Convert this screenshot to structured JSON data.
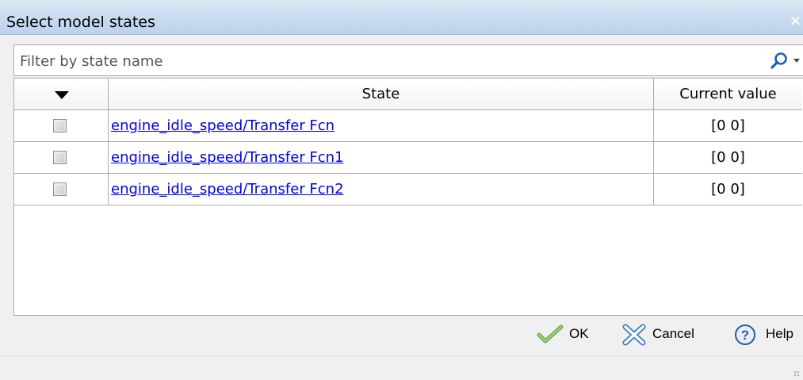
{
  "window": {
    "title": "Select model states",
    "close_glyph": "×"
  },
  "filter": {
    "placeholder": "Filter by state name",
    "value": "",
    "icon": "search-icon"
  },
  "table": {
    "columns": [
      "",
      "State",
      "Current value"
    ],
    "sort_icon": "sort-down-triangle-icon",
    "rows": [
      {
        "checked": false,
        "state": "engine_idle_speed/Transfer Fcn",
        "value": "[0 0]"
      },
      {
        "checked": false,
        "state": "engine_idle_speed/Transfer Fcn1",
        "value": "[0 0]"
      },
      {
        "checked": false,
        "state": "engine_idle_speed/Transfer Fcn2",
        "value": "[0 0]"
      }
    ]
  },
  "buttons": {
    "ok": "OK",
    "cancel": "Cancel",
    "help": "Help"
  },
  "colors": {
    "link": "#0000ee",
    "title_bar": "#c9dcf0",
    "ok_check": "#7cb342",
    "cancel_x": "#3d7fc4",
    "help_circle": "#2a5f9e"
  }
}
